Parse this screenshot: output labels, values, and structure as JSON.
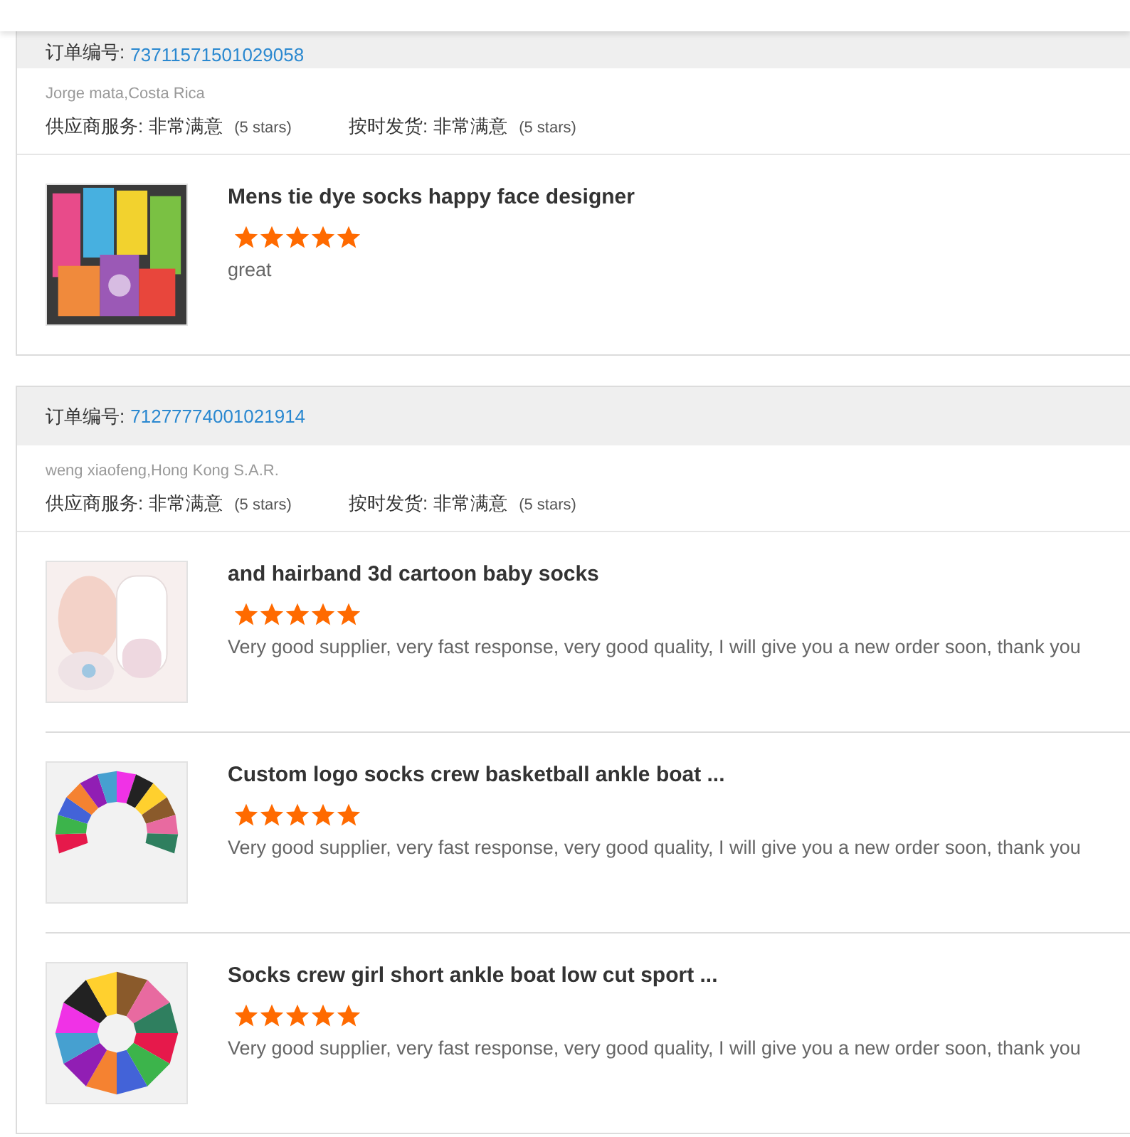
{
  "orders": [
    {
      "order_label": "订单编号:",
      "order_number": "73711571501029058",
      "buyer": "Jorge mata,Costa Rica",
      "ratings": [
        {
          "label": "供应商服务:",
          "value": "非常满意",
          "note": "(5 stars)"
        },
        {
          "label": "按时发货:",
          "value": "非常满意",
          "note": "(5 stars)"
        }
      ],
      "items": [
        {
          "title": "Mens tie dye socks happy face designer",
          "stars": 5,
          "comment": "great"
        }
      ]
    },
    {
      "order_label": "订单编号:",
      "order_number": "71277774001021914",
      "buyer": "weng xiaofeng,Hong Kong S.A.R.",
      "ratings": [
        {
          "label": "供应商服务:",
          "value": "非常满意",
          "note": "(5 stars)"
        },
        {
          "label": "按时发货:",
          "value": "非常满意",
          "note": "(5 stars)"
        }
      ],
      "items": [
        {
          "title": "and hairband 3d cartoon baby socks",
          "stars": 5,
          "comment": "Very good supplier, very fast response, very good quality, I will give you a new order soon, thank you"
        },
        {
          "title": "Custom logo socks crew basketball ankle boat ...",
          "stars": 5,
          "comment": "Very good supplier, very fast response, very good quality, I will give you a new order soon, thank you"
        },
        {
          "title": "Socks crew girl short ankle boat low cut sport ...",
          "stars": 5,
          "comment": "Very good supplier, very fast response, very good quality, I will give you a new order soon, thank you"
        }
      ]
    }
  ]
}
